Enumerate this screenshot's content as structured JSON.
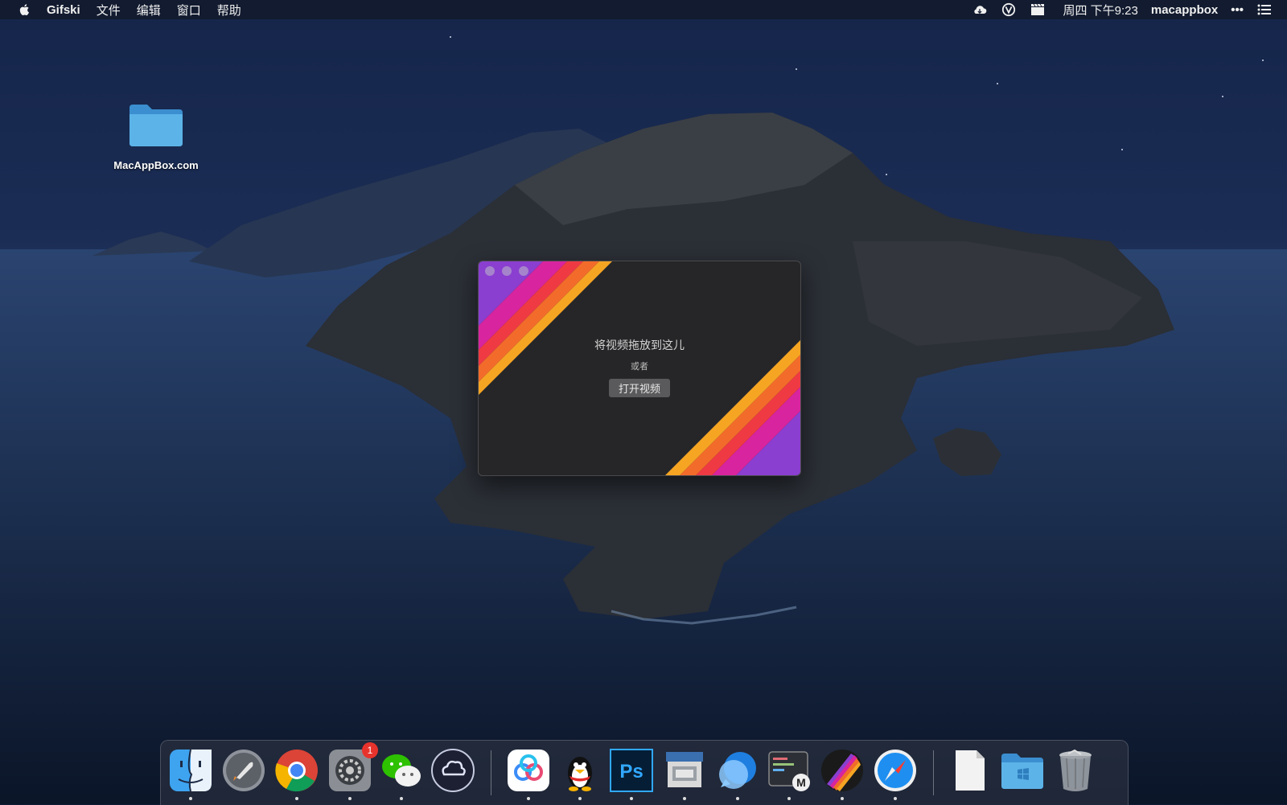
{
  "menubar": {
    "app_name": "Gifski",
    "menus": [
      "文件",
      "编辑",
      "窗口",
      "帮助"
    ],
    "status_icons": [
      "cloud-icon",
      "vpn-icon",
      "clapperboard-icon"
    ],
    "clock": "周四 下午9:23",
    "user": "macappbox",
    "more": "•••"
  },
  "desktop": {
    "folder_label": "MacAppBox.com"
  },
  "gifski": {
    "drop_title": "将视频拖放到这儿",
    "or_text": "或者",
    "open_button": "打开视频"
  },
  "dock": {
    "items": [
      {
        "name": "finder",
        "running": true
      },
      {
        "name": "launchpad",
        "running": false
      },
      {
        "name": "chrome",
        "running": true
      },
      {
        "name": "system-preferences",
        "running": true,
        "badge": "1"
      },
      {
        "name": "wechat",
        "running": true
      },
      {
        "name": "cloud-app",
        "running": false
      },
      {
        "name": "baidu-netdisk",
        "running": true
      },
      {
        "name": "qq",
        "running": true
      },
      {
        "name": "photoshop",
        "running": true
      },
      {
        "name": "screenshot-app",
        "running": true
      },
      {
        "name": "chat-bubble-app",
        "running": true
      },
      {
        "name": "code-editor",
        "running": true
      },
      {
        "name": "gifski",
        "running": true
      },
      {
        "name": "safari",
        "running": true
      },
      {
        "name": "document",
        "running": false
      },
      {
        "name": "windows-folder",
        "running": false
      },
      {
        "name": "trash",
        "running": false
      }
    ]
  }
}
